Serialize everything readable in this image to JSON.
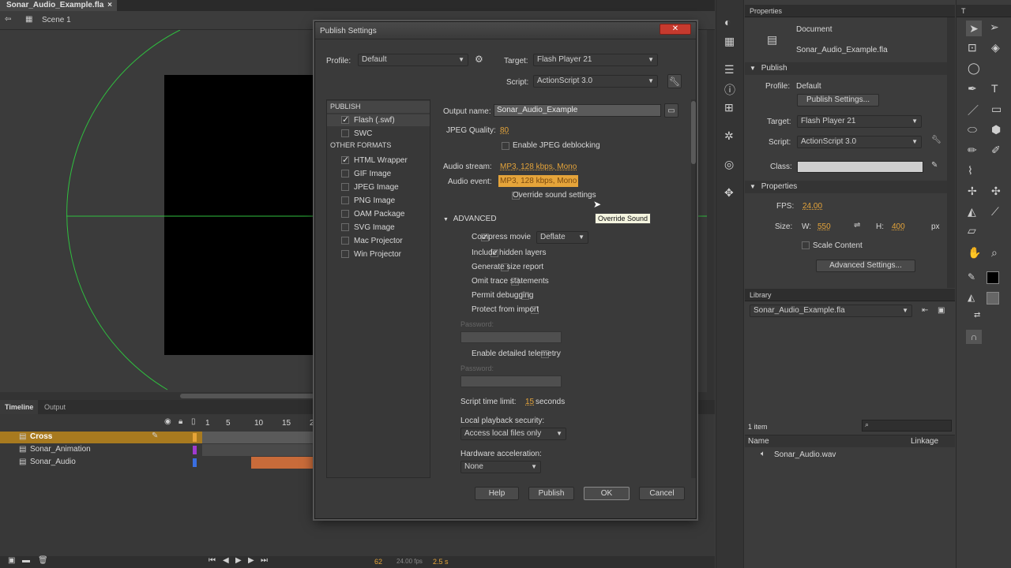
{
  "app": {
    "doc_tab": "Sonar_Audio_Example.fla",
    "scene": "Scene 1"
  },
  "timeline": {
    "tab_timeline": "Timeline",
    "tab_output": "Output",
    "ruler": [
      "1",
      "5",
      "10",
      "15",
      "2"
    ],
    "layers": [
      {
        "name": "Cross",
        "color": "#e6a437",
        "selected": true
      },
      {
        "name": "Sonar_Animation",
        "color": "#a03ad0",
        "selected": false
      },
      {
        "name": "Sonar_Audio",
        "color": "#3a6ee0",
        "selected": false
      }
    ],
    "frame": "62",
    "fps": "24.00 fps",
    "time": "2.5 s"
  },
  "dialog": {
    "title": "Publish Settings",
    "profile_label": "Profile:",
    "profile_value": "Default",
    "target_label": "Target:",
    "target_value": "Flash Player 21",
    "script_label": "Script:",
    "script_value": "ActionScript 3.0",
    "left": {
      "publish_header": "PUBLISH",
      "publish_items": [
        {
          "label": "Flash (.swf)",
          "checked": true
        },
        {
          "label": "SWC",
          "checked": false
        }
      ],
      "other_header": "OTHER FORMATS",
      "other_items": [
        {
          "label": "HTML Wrapper",
          "checked": true
        },
        {
          "label": "GIF Image",
          "checked": false
        },
        {
          "label": "JPEG Image",
          "checked": false
        },
        {
          "label": "PNG Image",
          "checked": false
        },
        {
          "label": "OAM Package",
          "checked": false
        },
        {
          "label": "SVG Image",
          "checked": false
        },
        {
          "label": "Mac Projector",
          "checked": false
        },
        {
          "label": "Win Projector",
          "checked": false
        }
      ]
    },
    "right": {
      "output_label": "Output name:",
      "output_value": "Sonar_Audio_Example",
      "jpeg_quality_label": "JPEG Quality:",
      "jpeg_quality_value": "80",
      "jpeg_deblock_label": "Enable JPEG deblocking",
      "audio_stream_label": "Audio stream:",
      "audio_stream_value": "MP3, 128 kbps, Mono",
      "audio_event_label": "Audio event:",
      "audio_event_value": "MP3, 128 kbps, Mono",
      "override_label": "Override sound settings",
      "tooltip": "Override Sound",
      "advanced_label": "ADVANCED",
      "compress_label": "Compress movie",
      "compress_value": "Deflate",
      "adv_options": [
        {
          "label": "Include hidden layers",
          "checked": true
        },
        {
          "label": "Generate size report",
          "checked": false
        },
        {
          "label": "Omit trace statements",
          "checked": false
        },
        {
          "label": "Permit debugging",
          "checked": false
        },
        {
          "label": "Protect from import",
          "checked": false
        }
      ],
      "password_label": "Password:",
      "telemetry_label": "Enable detailed telemetry",
      "password2_label": "Password:",
      "script_time_label": "Script time limit:",
      "script_time_value": "15",
      "script_time_unit": "seconds",
      "local_playback_label": "Local playback security:",
      "local_playback_value": "Access local files only",
      "hw_accel_label": "Hardware acceleration:",
      "hw_accel_value": "None"
    },
    "buttons": {
      "help": "Help",
      "publish": "Publish",
      "ok": "OK",
      "cancel": "Cancel"
    }
  },
  "properties": {
    "tab": "Properties",
    "doc_type": "Document",
    "doc_name": "Sonar_Audio_Example.fla",
    "publish_section": "Publish",
    "profile_label": "Profile:",
    "profile_value": "Default",
    "publish_settings_btn": "Publish Settings...",
    "target_label": "Target:",
    "target_value": "Flash Player 21",
    "script_label": "Script:",
    "script_value": "ActionScript 3.0",
    "class_label": "Class:",
    "props_section": "Properties",
    "fps_label": "FPS:",
    "fps_value": "24.00",
    "size_label": "Size:",
    "w_label": "W:",
    "w_value": "550",
    "h_label": "H:",
    "h_value": "400",
    "unit": "px",
    "scale_label": "Scale Content",
    "advanced_btn": "Advanced Settings..."
  },
  "library": {
    "tab": "Library",
    "file": "Sonar_Audio_Example.fla",
    "count": "1 item",
    "col_name": "Name",
    "col_linkage": "Linkage",
    "items": [
      "Sonar_Audio.wav"
    ]
  },
  "colors": {
    "accent_orange": "#e5a43a",
    "stage_line": "#2fbf3f"
  }
}
